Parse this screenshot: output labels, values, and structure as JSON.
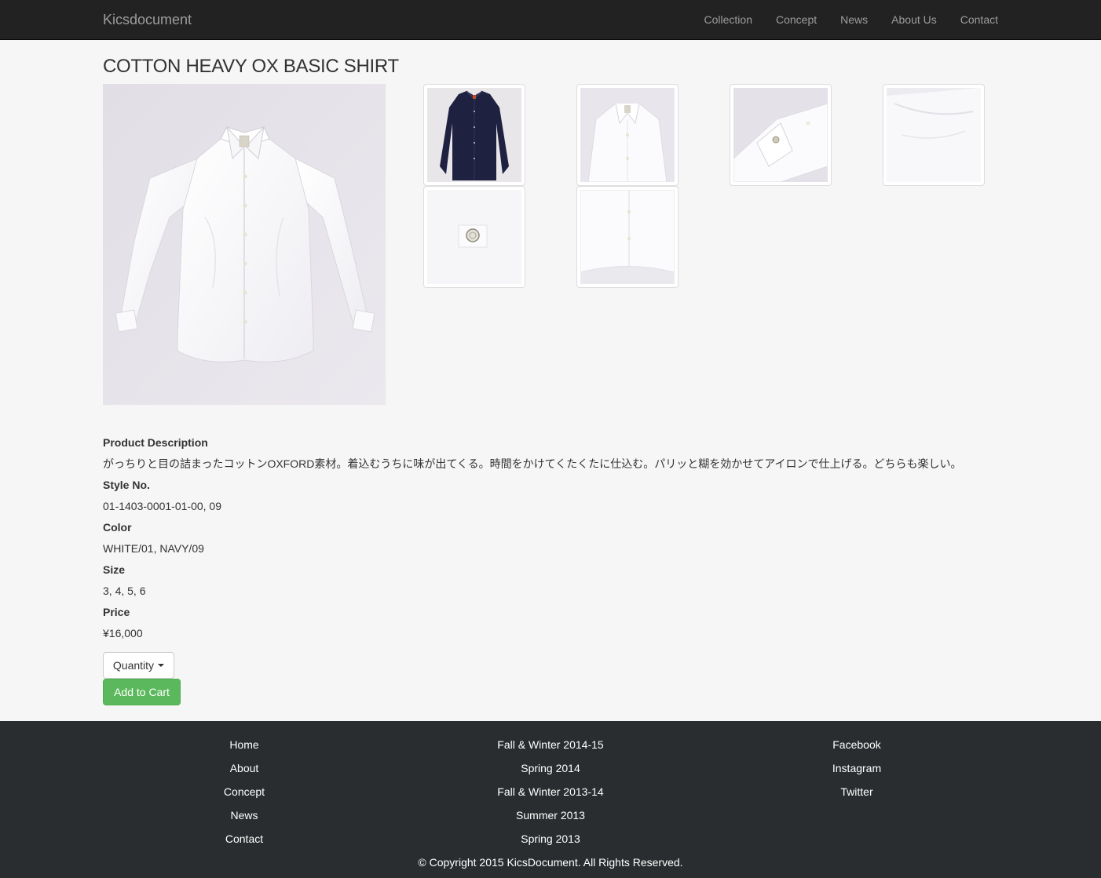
{
  "navbar": {
    "brand": "Kicsdocument",
    "links": [
      "Collection",
      "Concept",
      "News",
      "About Us",
      "Contact"
    ]
  },
  "product": {
    "title": "COTTON HEAVY OX BASIC SHIRT",
    "description_label": "Product Description",
    "description": "がっちりと目の詰まったコットンOXFORD素材。着込むうちに味が出てくる。時間をかけてくたくたに仕込む。パリッと糊を効かせてアイロンで仕上げる。どちらも楽しい。",
    "style_label": "Style No.",
    "style": "01-1403-0001-01-00, 09",
    "color_label": "Color",
    "color": "WHITE/01, NAVY/09",
    "size_label": "Size",
    "size": "3, 4, 5, 6",
    "price_label": "Price",
    "price": "¥16,000",
    "quantity_label": "Quantity",
    "cart_label": "Add to Cart"
  },
  "thumbnails": [
    "navy-shirt",
    "collar-detail",
    "cuff-detail",
    "shoulder-detail",
    "button-detail",
    "hem-detail"
  ],
  "footer": {
    "col1": [
      "Home",
      "About",
      "Concept",
      "News",
      "Contact"
    ],
    "col2": [
      "Fall & Winter 2014-15",
      "Spring 2014",
      "Fall & Winter 2013-14",
      "Summer 2013",
      "Spring 2013"
    ],
    "col3": [
      "Facebook",
      "Instagram",
      "Twitter"
    ],
    "copyright": "© Copyright 2015 KicsDocument. All Rights Reserved."
  },
  "colors": {
    "navbar_bg": "#222222",
    "footer_bg": "#2a2d2f",
    "cart_button": "#5cb85c"
  }
}
